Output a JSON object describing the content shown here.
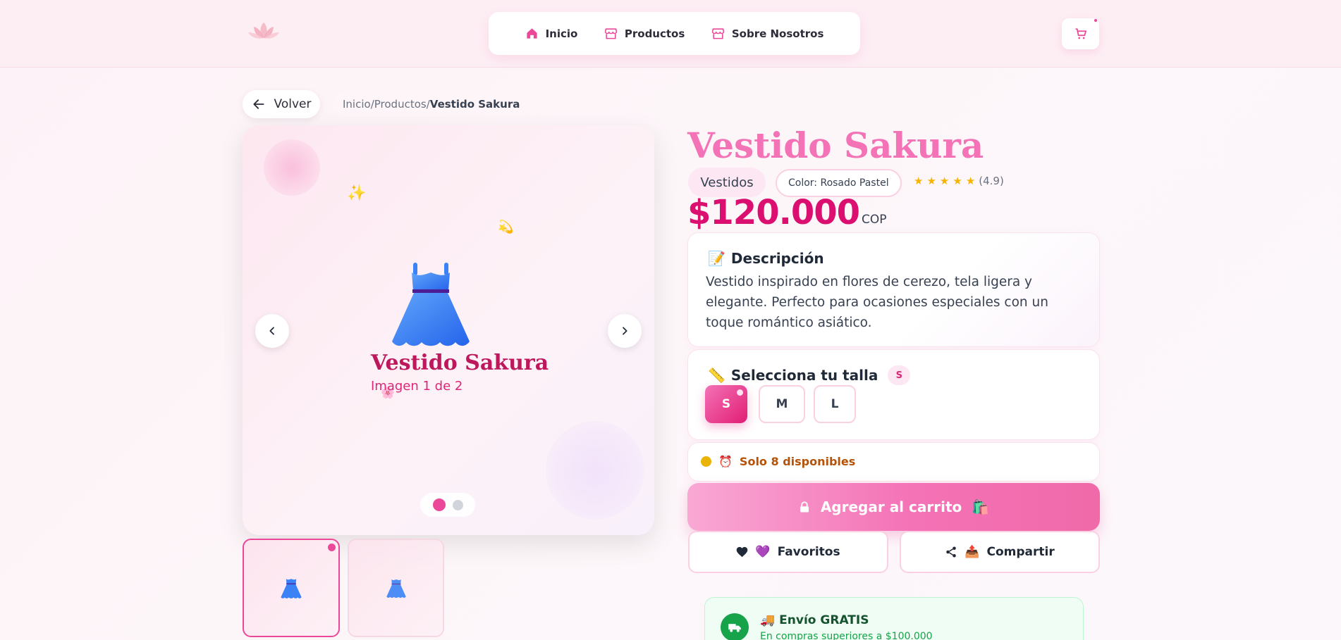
{
  "nav": {
    "items": [
      {
        "label": "Inicio",
        "icon": "home-icon"
      },
      {
        "label": "Productos",
        "icon": "store-icon"
      },
      {
        "label": "Sobre Nosotros",
        "icon": "store-icon"
      }
    ]
  },
  "back": {
    "label": "Volver"
  },
  "breadcrumb": {
    "home": "Inicio",
    "sep1": "/",
    "products": "Productos",
    "sep2": "/",
    "current": "Vestido Sakura"
  },
  "gallery": {
    "name": "Vestido Sakura",
    "counter": "Imagen 1 de 2",
    "sparkles": [
      "✨",
      "💫",
      "🌸"
    ]
  },
  "product": {
    "title": "Vestido Sakura",
    "category": "Vestidos",
    "color_badge": "Color: Rosado Pastel",
    "rating": 4.9,
    "rating_text": "(4.9)",
    "price": "$120.000",
    "currency": "COP"
  },
  "description": {
    "emoji": "📝",
    "heading": "Descripción",
    "text": "Vestido inspirado en flores de cerezo, tela ligera y elegante. Perfecto para ocasiones especiales con un toque romántico asiático."
  },
  "sizes": {
    "emoji": "📏",
    "heading": "Selecciona tu talla",
    "selected_pill": "S",
    "options": [
      "S",
      "M",
      "L"
    ],
    "selected": "S"
  },
  "stock": {
    "emoji": "⏰",
    "text": "Solo 8 disponibles"
  },
  "actions": {
    "add_to_cart": "Agregar al carrito",
    "add_emoji": "🛍️",
    "favorites": "Favoritos",
    "fav_emoji": "💜",
    "share": "Compartir",
    "share_emoji": "📤"
  },
  "shipping": {
    "emoji": "🚚",
    "title": "Envío GRATIS",
    "subtitle": "En compras superiores a $100.000"
  },
  "colors": {
    "accent": "#ec4899",
    "price": "#db0f6f",
    "title": "#f472b6",
    "dress": "#3b82f6",
    "shipping": "#16a34a"
  }
}
